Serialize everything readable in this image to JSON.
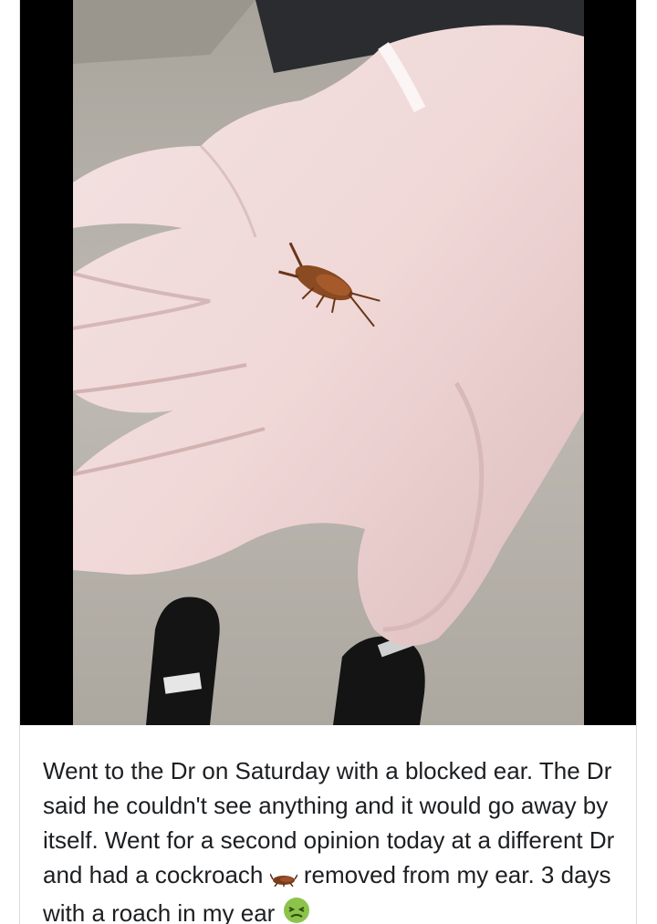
{
  "post": {
    "text_part1": "Went to the Dr on Saturday with a blocked ear. The Dr said he couldn't see anything and it would go away by itself. Went for a second opinion today at a different Dr and had a cockroach",
    "emoji_cockroach": "cockroach-emoji",
    "text_part2": "removed from my ear. 3 days with a roach in my ear",
    "emoji_face": "nauseated-face-emoji"
  },
  "media": {
    "description_icon": "photo-of-gloved-hand-holding-cockroach"
  },
  "colors": {
    "text": "#1c1e21",
    "letterbox": "#000000",
    "glove": "#efd6d6",
    "floor": "#b9b4ad",
    "shoe": "#151515",
    "cockroach": "#8a4a22",
    "border": "#dcdcdc"
  }
}
